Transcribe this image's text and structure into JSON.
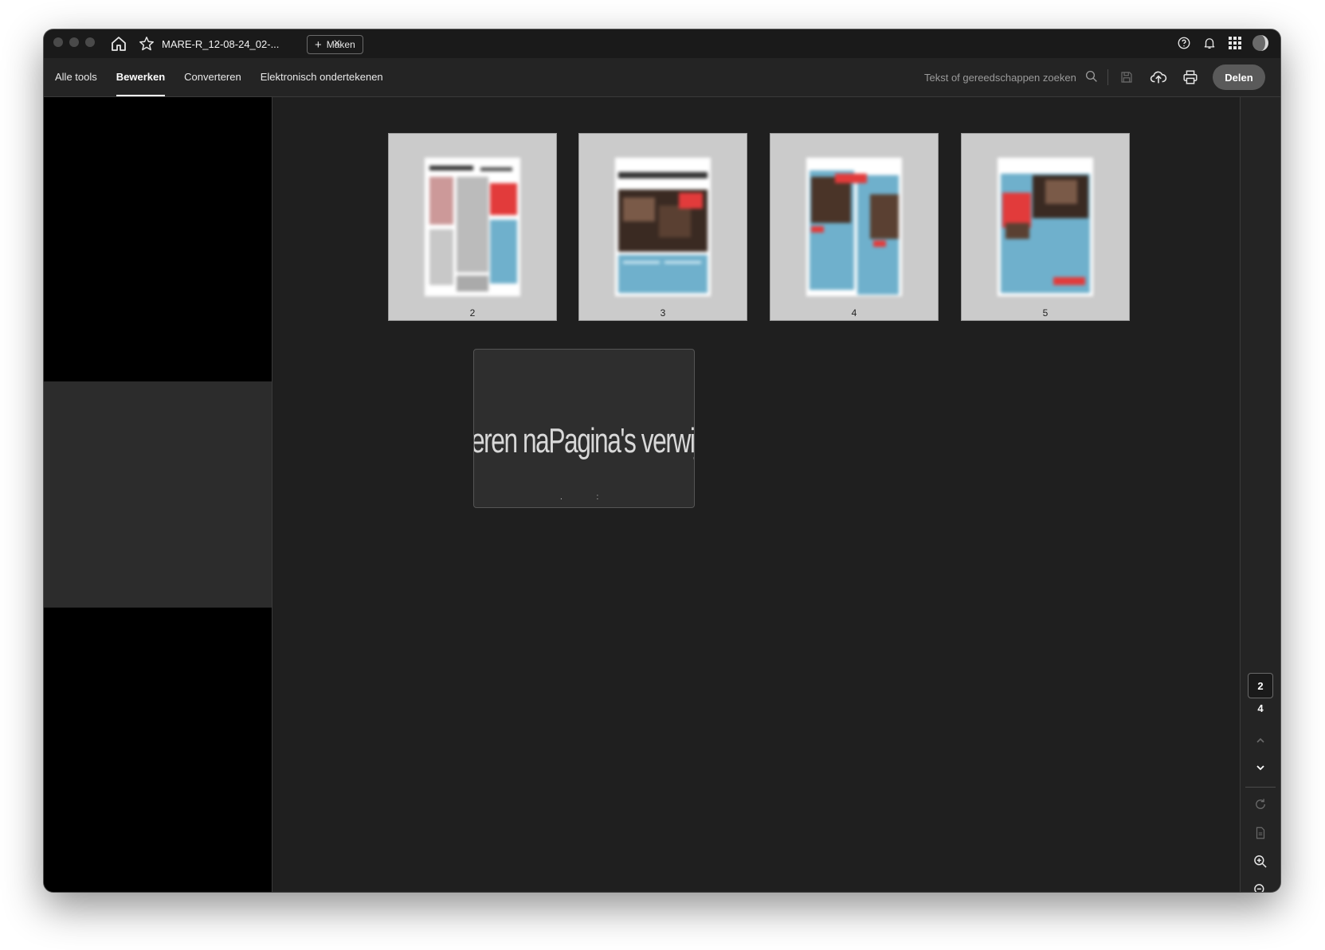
{
  "window": {
    "tab_title": "MARE-R_12-08-24_02-...",
    "tab_close": "×",
    "create_label": "Maken",
    "create_plus": "+"
  },
  "toolbar": {
    "menu": [
      "Alle tools",
      "Bewerken",
      "Converteren",
      "Elektronisch ondertekenen"
    ],
    "active_menu": "Bewerken",
    "search_placeholder": "Tekst of gereedschappen zoeken",
    "share_label": "Delen"
  },
  "thumbnails": [
    {
      "page": "2"
    },
    {
      "page": "3"
    },
    {
      "page": "4"
    },
    {
      "page": "5"
    }
  ],
  "popup": {
    "text": "eren naPagina's verwijde",
    "dots": ". :"
  },
  "navigation": {
    "current_page": "2",
    "total_pages": "4"
  },
  "colors": {
    "window_bg": "#1f1f1f",
    "toolbar_bg": "#242424",
    "thumb_bg": "#cbcbcb",
    "accent_red": "#e23b3b",
    "accent_blue": "#5ba3c2",
    "share_button": "#5a5a5a"
  },
  "icons": {
    "home": "home-icon",
    "star": "star-icon",
    "help": "help-icon",
    "bell": "bell-icon",
    "apps": "apps-grid-icon",
    "avatar": "avatar-icon",
    "search": "search-icon",
    "save": "save-icon",
    "upload": "cloud-upload-icon",
    "print": "print-icon",
    "up": "chevron-up-icon",
    "down": "chevron-down-icon",
    "rotate": "rotate-icon",
    "page": "page-icon",
    "zoom_in": "zoom-in-icon",
    "zoom_out": "zoom-out-icon"
  }
}
